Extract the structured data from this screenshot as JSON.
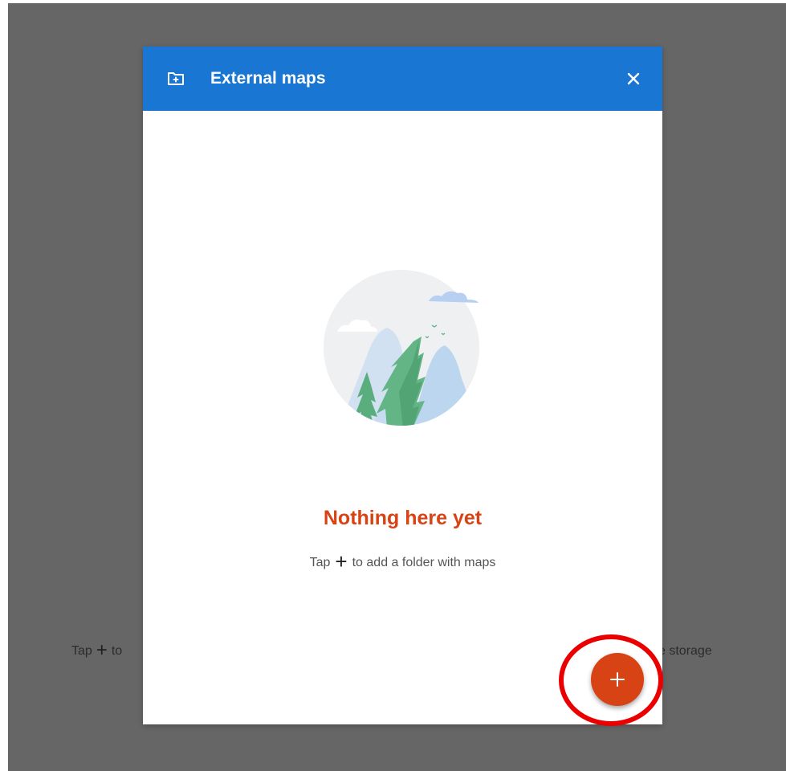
{
  "background": {
    "hint_left": {
      "prefix": "Tap",
      "suffix": "to"
    },
    "hint_right": "e storage",
    "hint_plus_glyph": "+"
  },
  "dialog": {
    "title": "External maps",
    "close_glyph": "✕",
    "icons": {
      "header": "folder-add-icon",
      "close": "close-icon",
      "illustration": "empty-state-landscape",
      "fab": "plus-icon"
    },
    "empty_state": {
      "title": "Nothing here yet",
      "hint_prefix": "Tap",
      "hint_plus_glyph": "+",
      "hint_suffix": "to add a folder with maps"
    }
  },
  "colors": {
    "header": "#1976d2",
    "accent": "#d84315",
    "overlay": "#666666",
    "annotation": "#ea0000"
  }
}
